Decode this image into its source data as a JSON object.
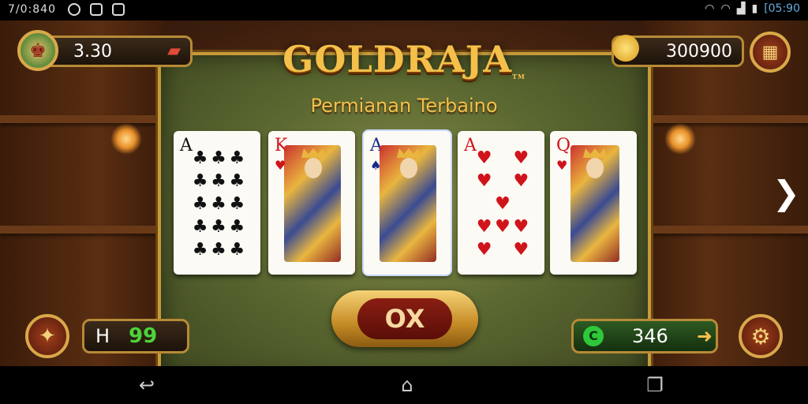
{
  "status_bar": {
    "time": "7/0:840",
    "battery_time": "[05:90"
  },
  "game": {
    "title": "GOLDRAJA",
    "title_mark": "TM",
    "tagline": "Permianan Terbaino",
    "player_score": "3.30",
    "coins": "300900",
    "chips": {
      "label": "H",
      "value": "99"
    },
    "credits": "346",
    "ok_button": "OX"
  },
  "cards": [
    {
      "rank": "A",
      "suit": "♣",
      "color": "black",
      "pips": [
        "♣",
        "♣",
        "♣",
        "♣",
        "♣",
        "♣",
        "♣",
        "♣",
        "♣",
        "♣",
        "♣",
        "♣",
        "♣",
        "♣",
        "♣"
      ]
    },
    {
      "rank": "K",
      "suit": "♥",
      "color": "red",
      "face": true
    },
    {
      "rank": "A",
      "suit": "♠",
      "color": "black",
      "face": true
    },
    {
      "rank": "A",
      "suit": "♥",
      "color": "red",
      "pips": [
        "♥",
        "",
        "♥",
        "♥",
        "",
        "♥",
        "",
        "♥",
        "",
        "♥",
        "♥",
        "♥",
        "♥",
        "",
        "♥"
      ]
    },
    {
      "rank": "Q",
      "suit": "♥",
      "color": "red",
      "face": true
    }
  ],
  "icons": {
    "avatar": "king-avatar-icon",
    "card_pack": "cards-icon",
    "coin_bag": "coin-bag-icon",
    "menu": "grid-menu-icon",
    "compass": "compass-icon",
    "credit": "coin-icon",
    "arrow": "arrow-right-icon",
    "settings": "gear-icon",
    "next": "chevron-right-icon"
  },
  "colors": {
    "gold": "#f4c04a",
    "felt": "#5d6a32",
    "chip_green": "#4cd43a"
  }
}
